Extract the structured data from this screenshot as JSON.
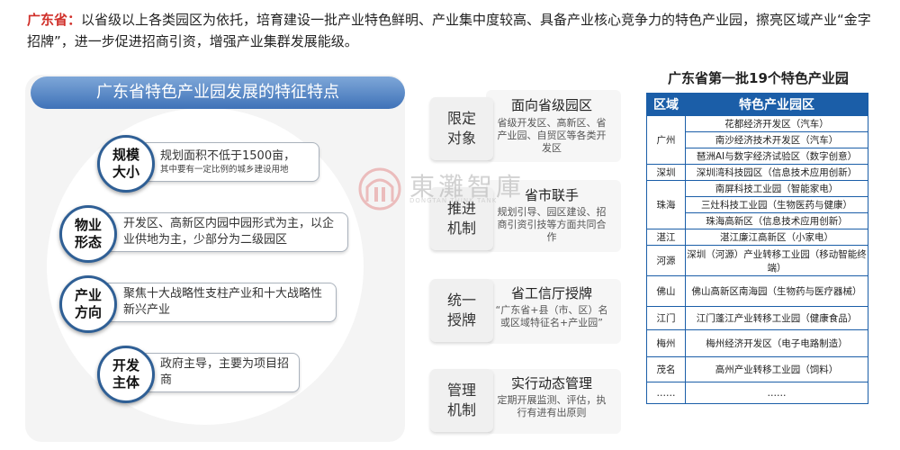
{
  "intro": {
    "keyword": "广东省：",
    "text": "以省级以上各类园区为依托，培育建设一批产业特色鲜明、产业集中度较高、具备产业核心竞争力的特色产业园，擦亮区域产业“金字招牌”，进一步促进招商引资，增强产业集群发展能级。"
  },
  "features": {
    "title": "广东省特色产业园发展的特征特点",
    "items": [
      {
        "label_1": "规模",
        "label_2": "大小",
        "text": "规划面积不低于1500亩，",
        "small": "其中要有一定比例的城乡建设用地"
      },
      {
        "label_1": "物业",
        "label_2": "形态",
        "text": "开发区、高新区内园中园形式为主，以企业供地为主，少部分为二级园区",
        "small": ""
      },
      {
        "label_1": "产业",
        "label_2": "方向",
        "text": "聚焦十大战略性支柱产业和十大战略性新兴产业",
        "small": ""
      },
      {
        "label_1": "开发",
        "label_2": "主体",
        "text": "政府主导，主要为项目招商",
        "small": ""
      }
    ]
  },
  "mechanisms": [
    {
      "label": "限定对象",
      "title": "面向省级园区",
      "desc": "省级开发区、高新区、省产业园、自贸区等各类开发区"
    },
    {
      "label": "推进机制",
      "title": "省市联手",
      "desc": "规划引导、园区建设、招商引资引技等方面共同合作"
    },
    {
      "label": "统一授牌",
      "title": "省工信厅授牌",
      "desc": "“广东省+县（市、区）名或区域特征名+产业园”"
    },
    {
      "label": "管理机制",
      "title": "实行动态管理",
      "desc": "定期开展监测、评估，执行有进有出原则"
    }
  ],
  "watermark": {
    "text": "東灘智庫",
    "sub": "DONGTAN THINK TANK"
  },
  "table": {
    "title": "广东省第一批19个特色产业园",
    "headers": [
      "区域",
      "特色产业园区"
    ],
    "groups": [
      {
        "city": "广州",
        "parks": [
          "花都经济开发区（汽车）",
          "南沙经济技术开发区（汽车）",
          "琶洲AI与数字经济试验区（数字创意）"
        ]
      },
      {
        "city": "深圳",
        "parks": [
          "深圳湾科技园区（信息技术应用创新）"
        ]
      },
      {
        "city": "珠海",
        "parks": [
          "南屏科技工业园（智能家电）",
          "三灶科技工业园（生物医药与健康）",
          "珠海高新区（信息技术应用创新）"
        ]
      },
      {
        "city": "湛江",
        "parks": [
          "湛江廉江高新区（小家电）"
        ]
      },
      {
        "city": "河源",
        "parks": [
          "深圳（河源）产业转移工业园（移动智能终端）"
        ]
      },
      {
        "city": "佛山",
        "parks": [
          "佛山高新区南海园（生物药与医疗器械）"
        ]
      },
      {
        "city": "江门",
        "parks": [
          "江门蓬江产业转移工业园（健康食品）"
        ]
      },
      {
        "city": "梅州",
        "parks": [
          "梅州经济开发区（电子电路制造）"
        ]
      },
      {
        "city": "茂名",
        "parks": [
          "高州产业转移工业园（饲料）"
        ]
      },
      {
        "city": "……",
        "parks": [
          "……"
        ]
      }
    ]
  }
}
